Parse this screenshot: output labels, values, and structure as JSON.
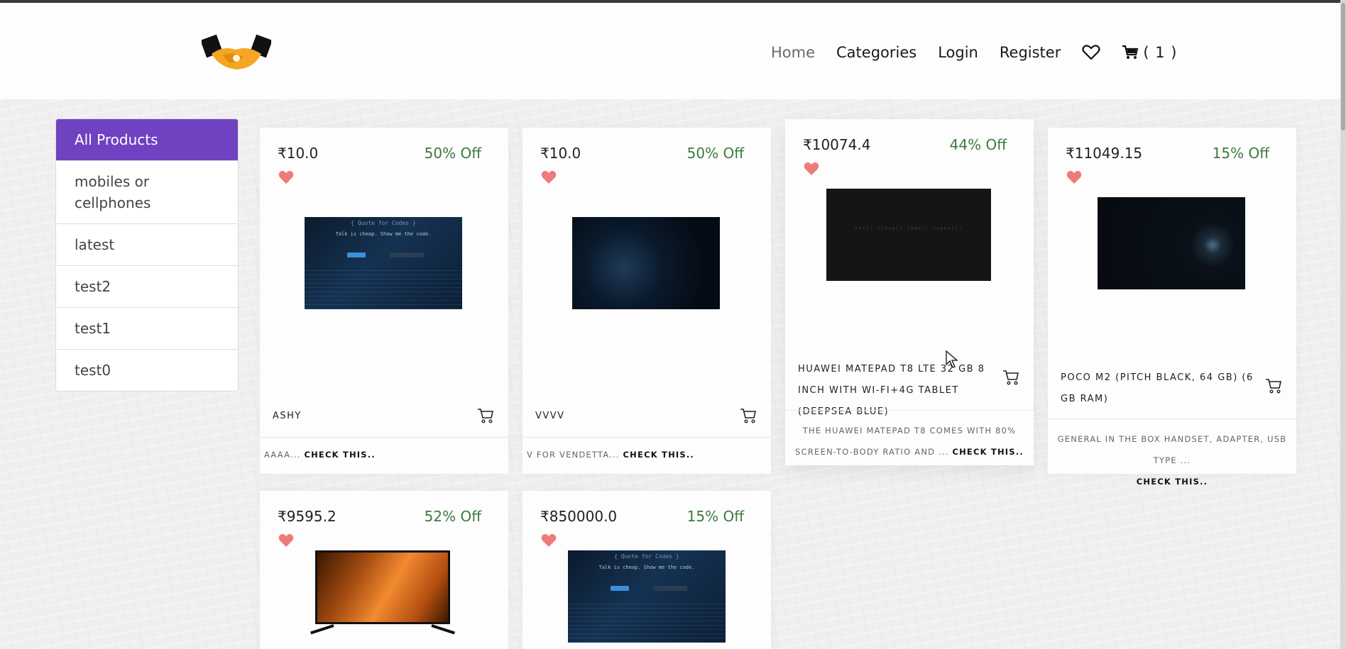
{
  "header": {
    "logo_icon": "handshake-logo",
    "nav": {
      "home": "Home",
      "categories": "Categories",
      "login": "Login",
      "register": "Register",
      "wishlist_icon": "heart-outline-icon",
      "cart_icon": "cart-icon",
      "cart_count": "( 1 )"
    }
  },
  "sidebar": {
    "items": [
      {
        "label": "All Products",
        "active": true
      },
      {
        "label": "mobiles or cellphones"
      },
      {
        "label": "latest"
      },
      {
        "label": "test2"
      },
      {
        "label": "test1"
      },
      {
        "label": "test0"
      }
    ]
  },
  "products": [
    {
      "price": "₹10.0",
      "discount": "50% Off",
      "name": "ASHY",
      "desc": "AAAA...",
      "cta": "CHECK THIS.."
    },
    {
      "price": "₹10.0",
      "discount": "50% Off",
      "name": "VVVV",
      "desc": "V FOR VENDETTA...",
      "cta": "CHECK THIS.."
    },
    {
      "price": "₹10074.4",
      "discount": "44% Off",
      "name": "HUAWEI MATEPAD T8 LTE 32 GB 8 INCH WITH WI-FI+4G TABLET (DEEPSEA BLUE)",
      "desc": "THE HUAWEI MATEPAD T8 COMES WITH 80% SCREEN-TO-BODY RATIO AND ...",
      "cta": "CHECK THIS.."
    },
    {
      "price": "₹11049.15",
      "discount": "15% Off",
      "name": "POCO M2 (PITCH BLACK, 64 GB) (6 GB RAM)",
      "desc": "GENERAL IN THE BOX HANDSET, ADAPTER, USB TYPE ...",
      "cta": "CHECK THIS.."
    },
    {
      "price": "₹9595.2",
      "discount": "52% Off"
    },
    {
      "price": "₹850000.0",
      "discount": "15% Off"
    }
  ],
  "screens": {
    "code_title": "{ Quote for Codes }",
    "code_quote": "Talk is cheap. Show me the code.",
    "rotation_text": "eat()  sleep()  code()  repeat()"
  },
  "colors": {
    "accent": "#6f42c1",
    "discount": "#3d7a3d",
    "heart": "#f07a7a"
  }
}
